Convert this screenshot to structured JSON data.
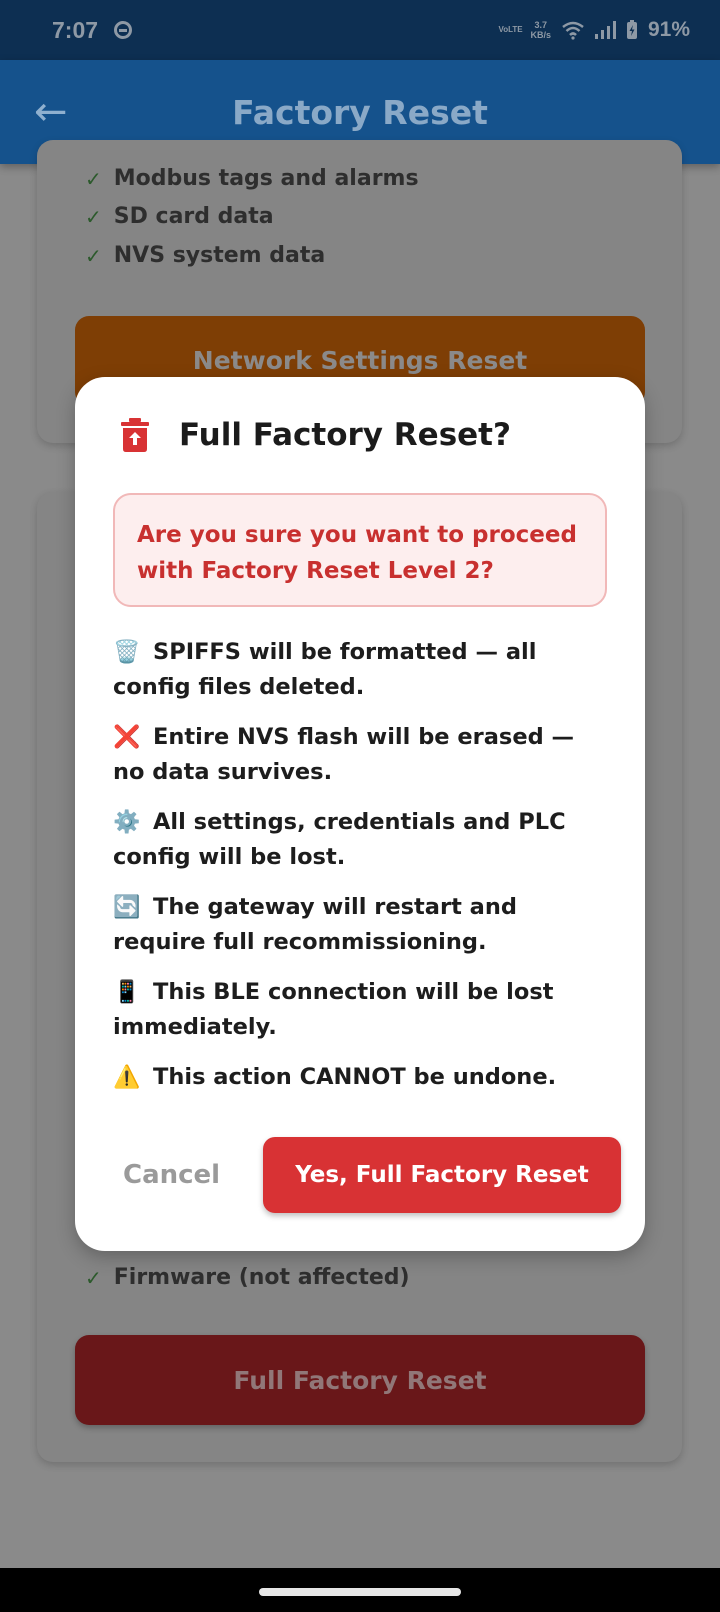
{
  "status_bar": {
    "time": "7:07",
    "network_label": "VoLTE",
    "speed_value": "3.7",
    "speed_unit": "KB/s",
    "battery": "91%"
  },
  "app_bar": {
    "title": "Factory Reset"
  },
  "background": {
    "card1_items": [
      "Modbus tags and alarms",
      "SD card data",
      "NVS system data"
    ],
    "network_button": "Network Settings Reset",
    "card2_item": "Firmware (not affected)",
    "full_button": "Full Factory Reset"
  },
  "dialog": {
    "title": "Full Factory Reset?",
    "warning": "Are you sure you want to proceed with Factory Reset Level 2?",
    "items": [
      {
        "icon": "🗑️",
        "text": "SPIFFS will be formatted — all config files deleted."
      },
      {
        "icon": "❌",
        "text": "Entire NVS flash will be erased — no data survives."
      },
      {
        "icon": "⚙️",
        "text": "All settings, credentials and PLC config will be lost."
      },
      {
        "icon": "🔄",
        "text": "The gateway will restart and require full recommissioning."
      },
      {
        "icon": "📱",
        "text": "This BLE connection will be lost immediately."
      },
      {
        "icon": "⚠️",
        "text": "This action CANNOT be undone."
      }
    ],
    "cancel_label": "Cancel",
    "confirm_label": "Yes, Full Factory Reset"
  },
  "colors": {
    "app_bar": "#15528c",
    "confirm": "#d83234",
    "warning_text": "#c8302f"
  }
}
